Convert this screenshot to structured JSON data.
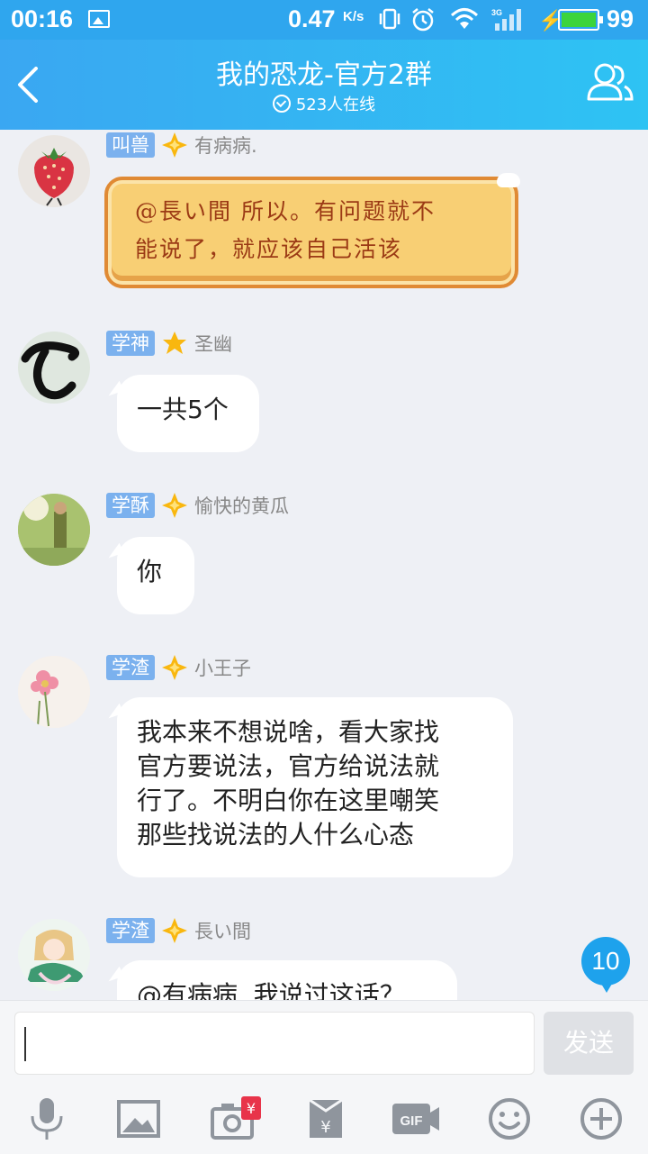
{
  "status_bar": {
    "time": "00:16",
    "net_speed": "0.47",
    "net_speed_unit": "K/s",
    "battery_level": "99",
    "network_type": "3G"
  },
  "header": {
    "title": "我的恐龙-官方2群",
    "online_count": "523人在线"
  },
  "messages": [
    {
      "tag": "叫兽",
      "nickname": "有病病.",
      "text": "@長い間 所以。有问题就不能说了，就应该自己活该",
      "style": "fancy-bubble"
    },
    {
      "tag": "学神",
      "nickname": "圣幽",
      "text": "一共5个"
    },
    {
      "tag": "学酥",
      "nickname": "愉快的黄瓜",
      "text": "你"
    },
    {
      "tag": "学渣",
      "nickname": "小王子",
      "text": "我本来不想说啥，看大家找官方要说法，官方给说法就行了。不明白你在这里嘲笑那些找说法的人什么心态"
    },
    {
      "tag": "学渣",
      "nickname": "長い間",
      "text": "@有病病. 我说过这话？"
    }
  ],
  "fancy_lines": [
    "@長い間 所以。有问题就不",
    "能说了，就应该自己活该"
  ],
  "bubble4_lines": [
    "我本来不想说啥，看大家找",
    "官方要说法，官方给说法就",
    "行了。不明白你在这里嘲笑",
    "那些找说法的人什么心态"
  ],
  "unread_badge": "10",
  "input": {
    "value": "",
    "send_label": "发送"
  },
  "toolbar": {
    "icons": [
      "microphone-icon",
      "image-icon",
      "camera-redpacket-icon",
      "red-envelope-icon",
      "gif-icon",
      "emoji-icon",
      "plus-icon"
    ],
    "gif_label": "GIF",
    "redpacket_label": "¥"
  },
  "colors": {
    "header_start": "#3aa7f2",
    "header_end": "#2ec3f3",
    "tag_bg": "#7bb1ee",
    "badge": "#1ea2ec",
    "fancy_bubble": "#f8cf74"
  }
}
